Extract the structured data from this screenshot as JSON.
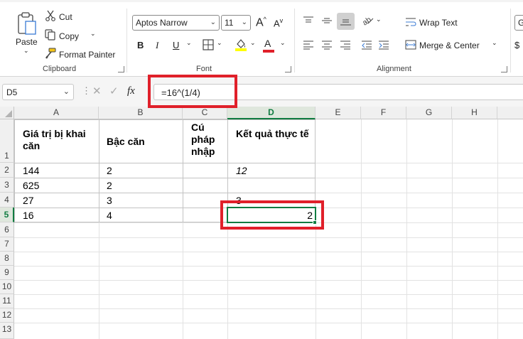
{
  "ribbon": {
    "clipboard": {
      "paste_label": "Paste",
      "cut_label": "Cut",
      "copy_label": "Copy",
      "format_painter_label": "Format Painter",
      "group_label": "Clipboard"
    },
    "font": {
      "font_name": "Aptos Narrow",
      "font_size": "11",
      "increase_size_label": "A",
      "decrease_size_label": "A",
      "bold_label": "B",
      "italic_label": "I",
      "underline_label": "U",
      "font_color_label": "A",
      "group_label": "Font",
      "fill_color": "#ffff00",
      "font_color": "#e0202a"
    },
    "alignment": {
      "wrap_text_label": "Wrap Text",
      "merge_center_label": "Merge & Center",
      "group_label": "Alignment"
    },
    "number": {
      "format_partial": "G"
    }
  },
  "formula_bar": {
    "name_box": "D5",
    "fx_label": "fx",
    "formula": "=16^(1/4)"
  },
  "grid": {
    "columns": [
      "A",
      "B",
      "C",
      "D",
      "E",
      "F",
      "G",
      "H"
    ],
    "rows": [
      "1",
      "2",
      "3",
      "4",
      "5",
      "6",
      "7",
      "8",
      "9",
      "10",
      "11",
      "12",
      "13"
    ],
    "selected_cell": "D5",
    "header": {
      "a1": "Giá trị bị khai căn",
      "b1": "Bậc căn",
      "c1": "Cú pháp nhập",
      "d1": "Kết quả thực tế"
    },
    "rows_data": [
      {
        "a": "144",
        "b": "2",
        "c": "",
        "d": "12"
      },
      {
        "a": "625",
        "b": "2",
        "c": "",
        "d": ""
      },
      {
        "a": "27",
        "b": "3",
        "c": "",
        "d": "3"
      },
      {
        "a": "16",
        "b": "4",
        "c": "",
        "d": "2"
      }
    ]
  },
  "colors": {
    "accent_green": "#107c41",
    "highlight_red": "#e0202a"
  }
}
